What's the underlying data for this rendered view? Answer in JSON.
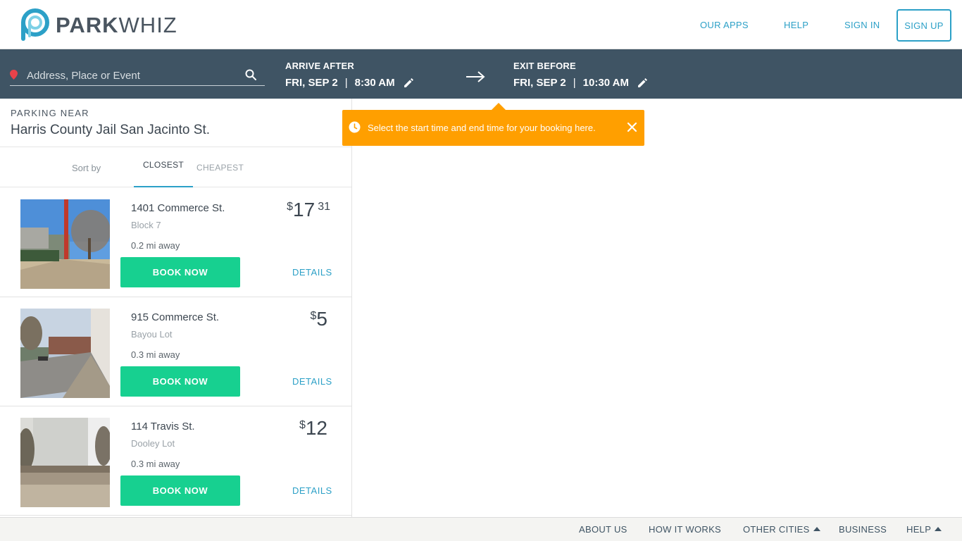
{
  "header": {
    "logo": {
      "part1": "PARK",
      "part2": "WHIZ"
    },
    "nav": {
      "apps": "OUR APPS",
      "help": "HELP",
      "signin": "SIGN IN",
      "signup": "SIGN UP"
    }
  },
  "search": {
    "placeholder": "Address, Place or Event",
    "arrive": {
      "label": "ARRIVE AFTER",
      "date": "FRI, SEP 2",
      "time": "8:30 AM"
    },
    "exit": {
      "label": "EXIT BEFORE",
      "date": "FRI, SEP 2",
      "time": "10:30 AM"
    },
    "separator": "|"
  },
  "panel": {
    "near_label": "PARKING NEAR",
    "near_place": "Harris County Jail San Jacinto St.",
    "sort_by": "Sort by",
    "tabs": {
      "closest": "CLOSEST",
      "cheapest": "CHEAPEST"
    }
  },
  "listings": [
    {
      "address": "1401 Commerce St.",
      "lot": "Block 7",
      "distance": "0.2 mi away",
      "price": {
        "currency": "$",
        "dollars": "17",
        "cents": "31"
      },
      "book": "BOOK NOW",
      "details": "DETAILS"
    },
    {
      "address": "915 Commerce St.",
      "lot": "Bayou Lot",
      "distance": "0.3 mi away",
      "price": {
        "currency": "$",
        "dollars": "5",
        "cents": ""
      },
      "book": "BOOK NOW",
      "details": "DETAILS"
    },
    {
      "address": "114 Travis St.",
      "lot": "Dooley Lot",
      "distance": "0.3 mi away",
      "price": {
        "currency": "$",
        "dollars": "12",
        "cents": ""
      },
      "book": "BOOK NOW",
      "details": "DETAILS"
    }
  ],
  "tooltip": {
    "text": "Select the start time and end time for your booking here."
  },
  "footer": {
    "about": "ABOUT US",
    "how": "HOW IT WORKS",
    "cities": "OTHER CITIES",
    "business": "BUSINESS",
    "help": "HELP"
  },
  "colors": {
    "brand_blue": "#2ca0c7",
    "bar_slate": "#3f5464",
    "book_green": "#17d090",
    "tooltip_orange": "#ff9f00"
  },
  "icons": [
    "location-pin-icon",
    "search-icon",
    "pencil-icon",
    "arrow-right-icon",
    "clock-icon",
    "close-icon",
    "caret-up-icon"
  ]
}
